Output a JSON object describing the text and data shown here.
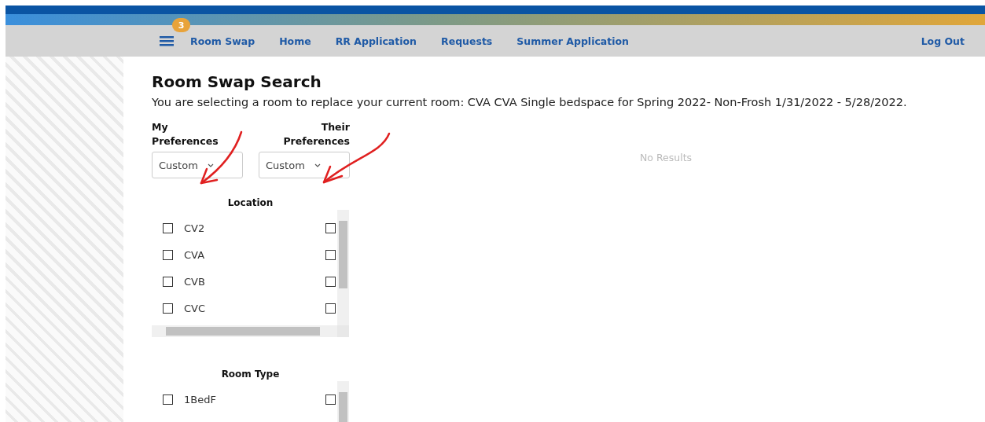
{
  "nav": {
    "badge": "3",
    "links": [
      {
        "label": "Room Swap"
      },
      {
        "label": "Home"
      },
      {
        "label": "RR Application"
      },
      {
        "label": "Requests"
      },
      {
        "label": "Summer Application"
      }
    ],
    "logout": "Log Out"
  },
  "page": {
    "title": "Room Swap Search",
    "description": "You are selecting a room to replace your current room: CVA CVA Single bedspace for Spring 2022- Non-Frosh 1/31/2022 - 5/28/2022.",
    "results": "No Results"
  },
  "preferences": [
    {
      "label": "My Preferences",
      "value": "Custom"
    },
    {
      "label": "Their Preferences",
      "value": "Custom"
    }
  ],
  "filters": [
    {
      "title": "Location",
      "options": [
        {
          "label": "CV2",
          "mine_checked": false,
          "their_checked": false
        },
        {
          "label": "CVA",
          "mine_checked": false,
          "their_checked": false
        },
        {
          "label": "CVB",
          "mine_checked": false,
          "their_checked": false
        },
        {
          "label": "CVC",
          "mine_checked": false,
          "their_checked": false
        }
      ]
    },
    {
      "title": "Room Type",
      "options": [
        {
          "label": "1BedF",
          "mine_checked": false,
          "their_checked": false
        }
      ]
    }
  ]
}
